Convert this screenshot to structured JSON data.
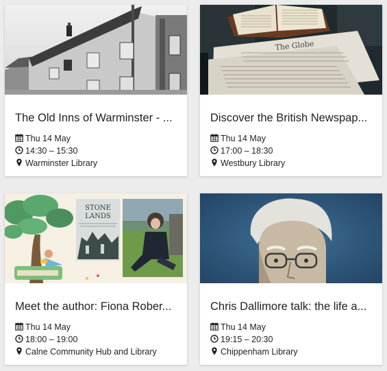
{
  "events": [
    {
      "title": "The Old Inns of Warminster - ...",
      "date": "Thu 14 May",
      "time": "14:30 – 15:30",
      "location": "Warminster Library",
      "image": "black-and-white-photo-of-old-inn-street"
    },
    {
      "title": "Discover the British Newspap...",
      "date": "Thu 14 May",
      "time": "17:00 – 18:30",
      "location": "Westbury Library",
      "image": "open-book-and-old-newspapers"
    },
    {
      "title": "Meet the author: Fiona Rober...",
      "date": "Thu 14 May",
      "time": "18:00 – 19:00",
      "location": "Calne Community Hub and Library",
      "image": "stone-lands-book-cover-and-author-photo",
      "book_title_line1": "STONE",
      "book_title_line2": "LANDS"
    },
    {
      "title": "Chris Dallimore talk: the life a...",
      "date": "Thu 14 May",
      "time": "19:15 – 20:30",
      "location": "Chippenham Library",
      "image": "portrait-of-elderly-man-with-glasses"
    }
  ],
  "icons": {
    "date": "calendar-icon",
    "time": "clock-icon",
    "location": "map-marker-icon"
  }
}
